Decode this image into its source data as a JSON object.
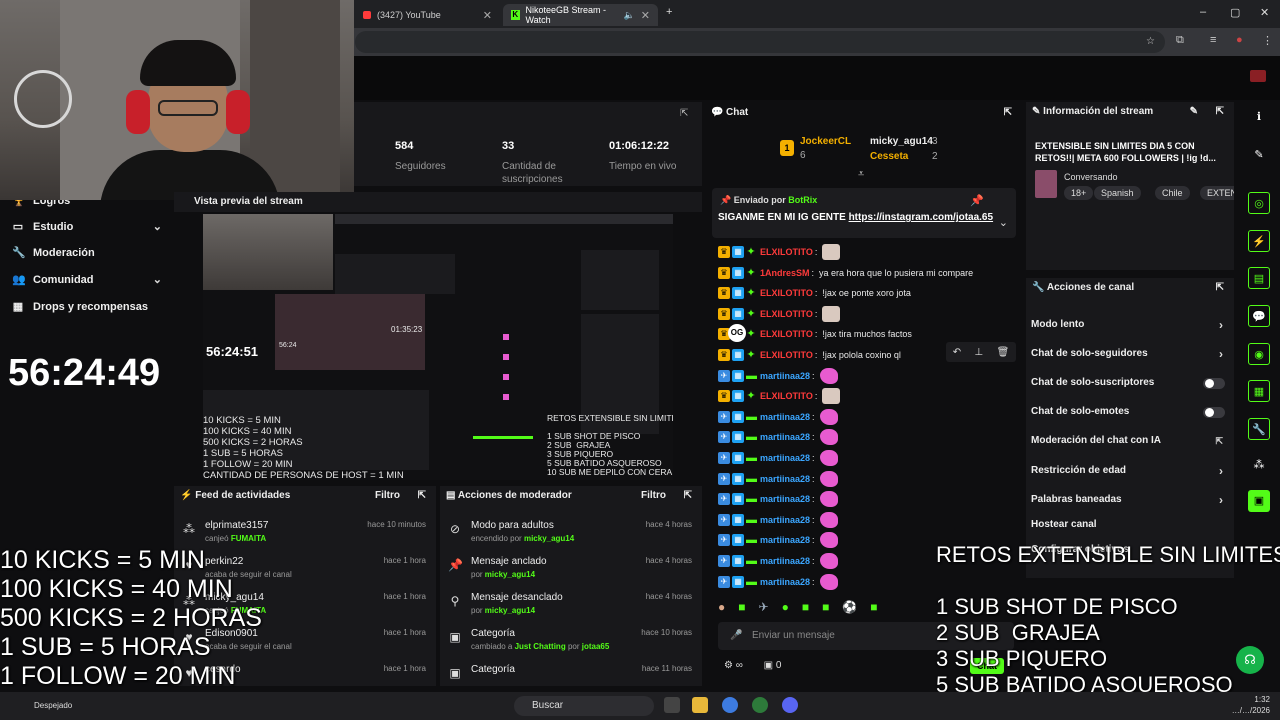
{
  "browser": {
    "tabs": [
      {
        "label": "(3427) YouTube"
      },
      {
        "label": "NikoteeGB Stream - Watch"
      }
    ],
    "new_tab": "+",
    "window_controls": {
      "min": "–",
      "max": "▢",
      "close": "✕"
    }
  },
  "sidebar": {
    "items": [
      {
        "label": "Logros",
        "icon": "trophy-icon"
      },
      {
        "label": "Estudio",
        "icon": "monitor-icon"
      },
      {
        "label": "Moderación",
        "icon": "wrench-icon"
      },
      {
        "label": "Comunidad",
        "icon": "people-icon"
      },
      {
        "label": "Drops y recompensas",
        "icon": "gift-icon"
      }
    ],
    "timer": "56:24:49"
  },
  "stats": {
    "followers": {
      "value": "584",
      "label": "Seguidores"
    },
    "subs": {
      "value": "33",
      "label": "Cantidad de suscripciones"
    },
    "live_time": {
      "value": "01:06:12:22",
      "label": "Tiempo en vivo"
    }
  },
  "preview": {
    "title": "Vista previa del stream",
    "timer": "56:24:51",
    "overlay_left": "10 KICKS = 5 MIN\n100 KICKS = 40 MIN\n500 KICKS = 2 HORAS\n1 SUB = 5 HORAS\n1 FOLLOW = 20 MIN\nCANTIDAD DE PERSONAS DE HOST = 1 MIN",
    "overlay_right": "RETOS EXTENSIBLE SIN LIMITES\n\n1 SUB SHOT DE PISCO\n2 SUB  GRAJEA\n3 SUB PIQUERO\n5 SUB BATIDO ASQUEROSO\n10 SUB ME DEPILO CON CERA",
    "inner_timer": "01:35:23",
    "inner_timer2": "56:24"
  },
  "feed": {
    "title": "Feed de actividades",
    "filter": "Filtro",
    "rows": [
      {
        "user": "elprimate3157",
        "action": "canjeó",
        "highlight": "FUMAITA",
        "time": "hace 10 minutos"
      },
      {
        "user": "perkin22",
        "action": "acaba de seguir el canal",
        "highlight": "",
        "time": "hace 1 hora"
      },
      {
        "user": "micky_agu14",
        "action": "canjeó",
        "highlight": "FUMAITA",
        "time": "hace 1 hora"
      },
      {
        "user": "Edison0901",
        "action": "acaba de seguir el canal",
        "highlight": "",
        "time": "hace 1 hora"
      },
      {
        "user": "cesardo",
        "action": "",
        "highlight": "",
        "time": "hace 1 hora"
      }
    ]
  },
  "mod_actions": {
    "title": "Acciones de moderador",
    "filter": "Filtro",
    "rows": [
      {
        "title": "Modo para adultos",
        "sub": "encendido por",
        "who": "micky_agu14",
        "time": "hace 4 horas"
      },
      {
        "title": "Mensaje anclado",
        "sub": "por",
        "who": "micky_agu14",
        "time": "hace 4 horas"
      },
      {
        "title": "Mensaje desanclado",
        "sub": "por",
        "who": "micky_agu14",
        "time": "hace 4 horas"
      },
      {
        "title": "Categoría",
        "sub": "cambiado a",
        "who": "Just Chatting",
        "extra": "por",
        "who2": "jotaa65",
        "time": "hace 10 horas"
      },
      {
        "title": "Categoría",
        "sub": "",
        "who": "",
        "time": "hace 11 horas"
      }
    ]
  },
  "chat": {
    "title": "Chat",
    "gifters": [
      {
        "name": "JockeerCL",
        "count": "6"
      },
      {
        "name": "micky_agu14",
        "count": "3"
      },
      {
        "name": "Cesseta",
        "count": "2"
      }
    ],
    "pinned": {
      "label": "Enviado por",
      "by": "BotRix",
      "text": "SIGANME EN MI IG GENTE",
      "link": "https://instagram.com/jotaa.65"
    },
    "messages": [
      {
        "user": "ELXILOTITO",
        "color": "#ff3b3b",
        "text": "",
        "emote": "face"
      },
      {
        "user": "1AndresSM",
        "color": "#ff3b3b",
        "text": "ya era hora que lo pusiera mi compare",
        "emote": ""
      },
      {
        "user": "ELXILOTITO",
        "color": "#ff3b3b",
        "text": "!jax oe ponte xoro jota",
        "emote": ""
      },
      {
        "user": "ELXILOTITO",
        "color": "#ff3b3b",
        "text": "",
        "emote": "face"
      },
      {
        "user": "ELXILOTITO",
        "color": "#ff3b3b",
        "text": "!jax tira muchos factos",
        "emote": ""
      },
      {
        "user": "ELXILOTITO",
        "color": "#ff3b3b",
        "text": "!jax polola coxino ql",
        "emote": ""
      },
      {
        "user": "martiinaa28",
        "color": "#3ba6ff",
        "text": "",
        "emote": "pink"
      },
      {
        "user": "ELXILOTITO",
        "color": "#ff3b3b",
        "text": "",
        "emote": "face"
      },
      {
        "user": "martiinaa28",
        "color": "#3ba6ff",
        "text": "",
        "emote": "pink"
      },
      {
        "user": "martiinaa28",
        "color": "#3ba6ff",
        "text": "",
        "emote": "pink"
      },
      {
        "user": "martiinaa28",
        "color": "#3ba6ff",
        "text": "",
        "emote": "pink"
      },
      {
        "user": "martiinaa28",
        "color": "#3ba6ff",
        "text": "",
        "emote": "pink"
      },
      {
        "user": "martiinaa28",
        "color": "#3ba6ff",
        "text": "",
        "emote": "pink"
      },
      {
        "user": "martiinaa28",
        "color": "#3ba6ff",
        "text": "",
        "emote": "pink"
      },
      {
        "user": "martiinaa28",
        "color": "#3ba6ff",
        "text": "",
        "emote": "pink"
      },
      {
        "user": "martiinaa28",
        "color": "#3ba6ff",
        "text": "",
        "emote": "pink"
      },
      {
        "user": "martiinaa28",
        "color": "#3ba6ff",
        "text": "",
        "emote": "pink"
      }
    ],
    "input_placeholder": "Enviar un mensaje",
    "send_label": "Chat",
    "footer_count": "0",
    "og_badge": "OG"
  },
  "stream_info": {
    "title": "Información del stream",
    "stream_title": "EXTENSIBLE SIN LIMITES DIA 5 CON RETOS!!| META 600 FOLLOWERS | !ig !d...",
    "category": "Conversando",
    "tags": [
      "18+",
      "Spanish",
      "Chile",
      "EXTENS"
    ]
  },
  "channel_actions": {
    "title": "Acciones de canal",
    "items": [
      {
        "label": "Modo lento",
        "type": "chevron"
      },
      {
        "label": "Chat de solo-seguidores",
        "type": "chevron"
      },
      {
        "label": "Chat de solo-suscriptores",
        "type": "toggle"
      },
      {
        "label": "Chat de solo-emotes",
        "type": "toggle"
      },
      {
        "label": "Moderación del chat con IA",
        "type": "link"
      },
      {
        "label": "Restricción de edad",
        "type": "chevron"
      },
      {
        "label": "Palabras baneadas",
        "type": "chevron"
      },
      {
        "label": "Hostear canal",
        "type": "none"
      },
      {
        "label": "Configurar objetivos",
        "type": "none"
      }
    ]
  },
  "taskbar": {
    "search": "Buscar",
    "time": "1:32",
    "date": "…/…/2026",
    "weather": "Despejado"
  },
  "colors": {
    "accent": "#53fc18",
    "bg": "#0e0e10",
    "panel": "#18181b"
  }
}
